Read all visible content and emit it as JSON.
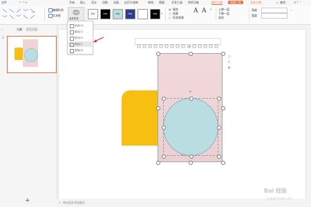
{
  "menubar": {
    "file_label": "文件",
    "tabs": [
      "开始",
      "插入",
      "设计",
      "切换",
      "动画",
      "幻灯片放映",
      "审阅",
      "视图",
      "开发工具",
      "特色功能"
    ],
    "tab_picture_tools": "图片工具",
    "tab_drawing_tools": "绘图工具",
    "tab_text_tools": "文本工具",
    "search_label": "查找"
  },
  "ribbon": {
    "style_boxes": [
      {
        "label": "Abc",
        "bg": "#ffffff",
        "fg": "#333333"
      },
      {
        "label": "Abc",
        "bg": "#000000",
        "fg": "#ffffff"
      },
      {
        "label": "Abc",
        "bg": "#b9dde0",
        "fg": "#333333"
      },
      {
        "label": "Abc",
        "bg": "#2f3d8c",
        "fg": "#ffffff"
      },
      {
        "label": "",
        "bg": "#ffffff",
        "fg": "#333333"
      },
      {
        "label": "Abc",
        "bg": "#000000",
        "fg": "#ffffff"
      }
    ],
    "edit_shape_label": "编辑形状",
    "text_box_label": "文本框",
    "merge_shapes_label": "合并形状",
    "fill_label": "填充",
    "outline_label": "轮廓",
    "shape_effects_label": "形状效果",
    "up_one_layer_label": "上移一层",
    "down_one_layer_label": "下移一层",
    "group_label": "组合",
    "height_label": "高度",
    "width_label": "宽度"
  },
  "dropdown": {
    "items": [
      "结合(U)",
      "组合(C)",
      "拆分(F)",
      "相交(I)",
      "剪除(S)"
    ],
    "hovered_index": 3
  },
  "left_panel": {
    "tab_outline": "大纲",
    "tab_slides": "幻灯片",
    "slide_number": "1",
    "add_slide_glyph": "+"
  },
  "status": {
    "note_placeholder": "单击此处添加备注"
  },
  "watermark": {
    "text": "Bai 经验",
    "url": "jingyan.baidu.com"
  },
  "colors": {
    "accent": "#f26b3a",
    "yellow_shape": "#f7bf12",
    "pink_image": "#efd3d6",
    "circle": "#b9dde0"
  }
}
